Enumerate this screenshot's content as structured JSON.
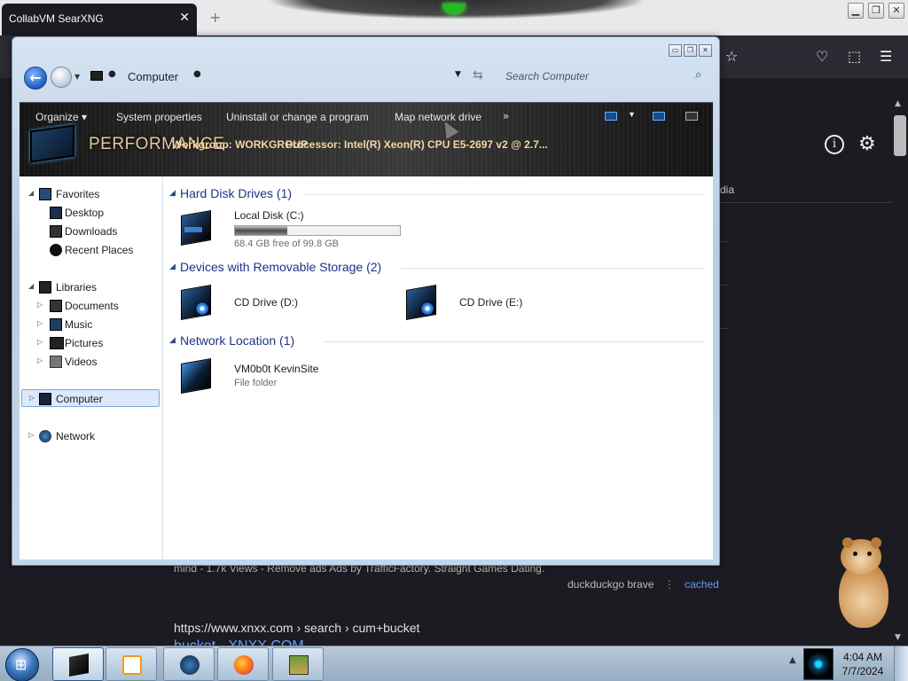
{
  "browser": {
    "tab_title": "CollabVM SearXNG",
    "tab_close": "✕",
    "new_tab": "+",
    "toolbar_icons": [
      "star-icon",
      "pocket-icon",
      "extensions-icon",
      "menu-icon"
    ],
    "header_fragment": "dia"
  },
  "explorer": {
    "address": {
      "location": "Computer",
      "separator": "▸"
    },
    "search": {
      "placeholder": "Search Computer"
    },
    "command_bar": {
      "organize": "Organize ▾",
      "system_properties": "System properties",
      "uninstall": "Uninstall or change a program",
      "map_network_drive": "Map network drive",
      "more": "»"
    },
    "details": {
      "performance_label": "PERFORMANCE",
      "workgroup": "Workgroup: WORKGROUP",
      "processor": "Processor: Intel(R) Xeon(R) CPU E5-2697 v2 @ 2.7..."
    },
    "nav": {
      "favorites": "Favorites",
      "desktop": "Desktop",
      "downloads": "Downloads",
      "recent_places": "Recent Places",
      "libraries": "Libraries",
      "documents": "Documents",
      "music": "Music",
      "pictures": "Pictures",
      "videos": "Videos",
      "computer": "Computer",
      "network": "Network"
    },
    "groups": {
      "hard_disks": "Hard Disk Drives (1)",
      "removable": "Devices with Removable Storage (2)",
      "network_location": "Network Location (1)"
    },
    "items": {
      "local_disk_name": "Local Disk (C:)",
      "local_disk_free": "68.4 GB free of 99.8 GB",
      "local_disk_used_fraction": 0.315,
      "cd_d": "CD Drive (D:)",
      "cd_e": "CD Drive (E:)",
      "net_name": "VM0b0t KevinSite",
      "net_type": "File folder"
    }
  },
  "search_result": {
    "snippet": "mind - 1.7k Views - Remove ads Ads by TrafficFactory. Straight Games Dating.",
    "engines": "duckduckgo  brave",
    "cached": "cached",
    "url": "https://www.xnxx.com  › search › cum+bucket",
    "title": "bucket - XNXX.COM"
  },
  "taskbar": {
    "time": "4:04 AM",
    "date": "7/7/2024",
    "items": [
      "explorer",
      "media-player",
      "network-app",
      "firefox",
      "box-game"
    ]
  }
}
